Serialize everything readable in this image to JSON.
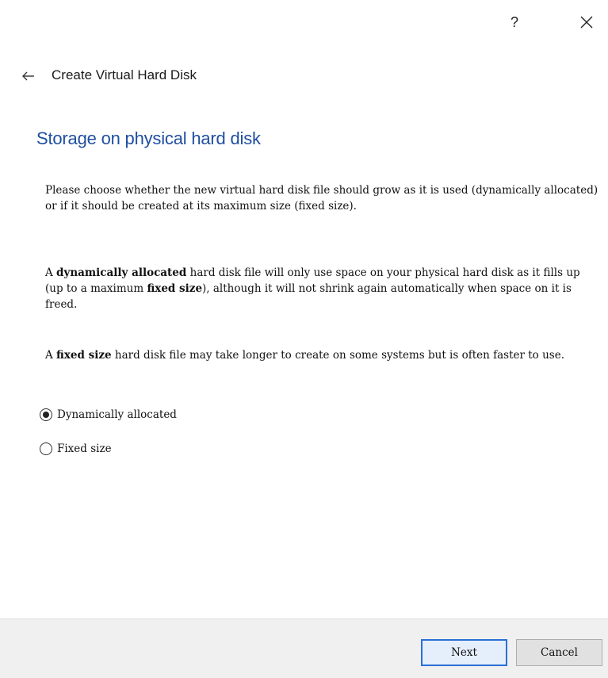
{
  "titlebar": {
    "help_label": "?"
  },
  "wizard": {
    "title": "Create Virtual Hard Disk"
  },
  "page": {
    "heading": "Storage on physical hard disk",
    "paragraph1": "Please choose whether the new virtual hard disk file should grow as it is used (dynamically allocated) or if it should be created at its maximum size (fixed size).",
    "paragraph2": {
      "part1": "A ",
      "bold1": "dynamically allocated",
      "part2": " hard disk file will only use space on your physical hard disk as it fills up (up to a maximum ",
      "bold2": "fixed size",
      "part3": "), although it will not shrink again automatically when space on it is freed."
    },
    "paragraph3": {
      "part1": "A ",
      "bold1": "fixed size",
      "part2": " hard disk file may take longer to create on some systems but is often faster to use."
    }
  },
  "options": [
    {
      "label": "Dynamically allocated",
      "selected": true
    },
    {
      "label": "Fixed size",
      "selected": false
    }
  ],
  "footer": {
    "next_label": "Next",
    "cancel_label": "Cancel"
  },
  "colors": {
    "heading": "#1f4fa0",
    "default_button_border": "#2a6fd6",
    "footer_bg": "#f0f0f0"
  },
  "icons": {
    "back": "back-arrow-icon",
    "close": "close-icon",
    "help": "help-icon"
  }
}
